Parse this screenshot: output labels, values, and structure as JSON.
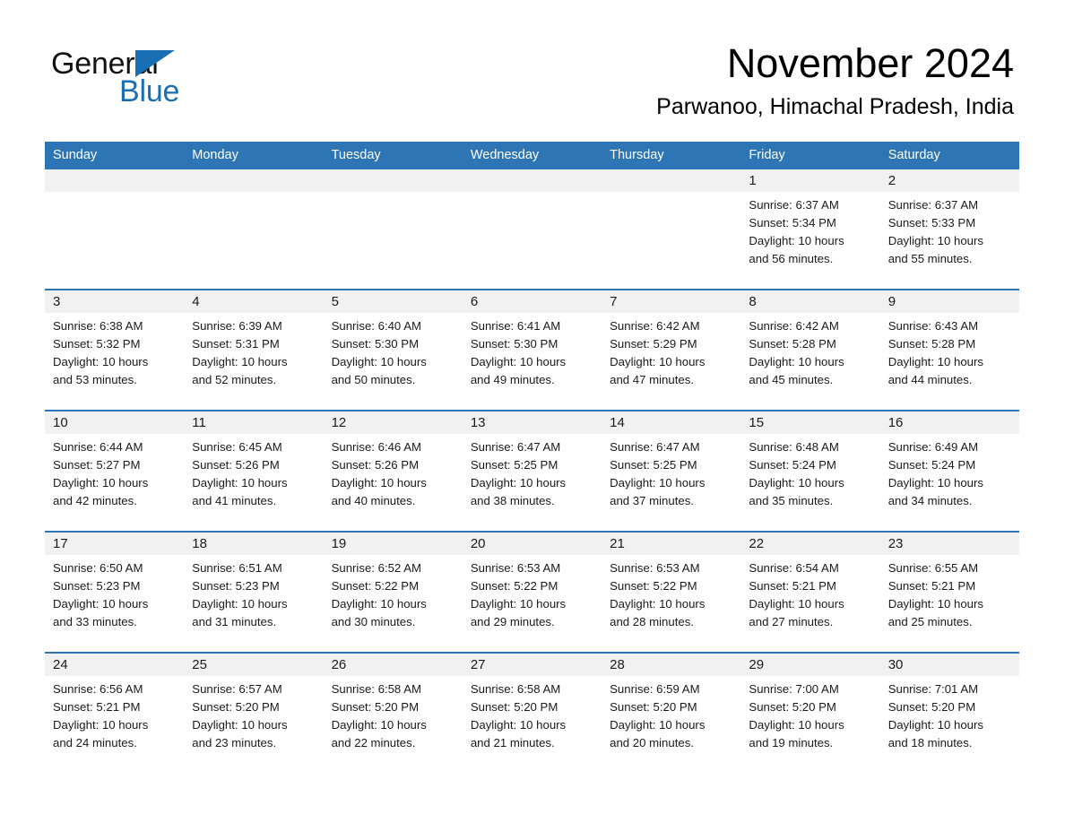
{
  "brand": {
    "name_part1": "General",
    "name_part2": "Blue",
    "accent_color": "#1a6fb4"
  },
  "header": {
    "month_title": "November 2024",
    "location": "Parwanoo, Himachal Pradesh, India"
  },
  "theme": {
    "header_blue": "#2e75b6",
    "day_band_gray": "#f1f1f1",
    "cell_white": "#ffffff"
  },
  "calendar": {
    "weekdays": [
      "Sunday",
      "Monday",
      "Tuesday",
      "Wednesday",
      "Thursday",
      "Friday",
      "Saturday"
    ],
    "weeks": [
      [
        {
          "day": "",
          "sunrise": "",
          "sunset": "",
          "daylight_line1": "",
          "daylight_line2": "",
          "empty": true
        },
        {
          "day": "",
          "sunrise": "",
          "sunset": "",
          "daylight_line1": "",
          "daylight_line2": "",
          "empty": true
        },
        {
          "day": "",
          "sunrise": "",
          "sunset": "",
          "daylight_line1": "",
          "daylight_line2": "",
          "empty": true
        },
        {
          "day": "",
          "sunrise": "",
          "sunset": "",
          "daylight_line1": "",
          "daylight_line2": "",
          "empty": true
        },
        {
          "day": "",
          "sunrise": "",
          "sunset": "",
          "daylight_line1": "",
          "daylight_line2": "",
          "empty": true
        },
        {
          "day": "1",
          "sunrise": "Sunrise: 6:37 AM",
          "sunset": "Sunset: 5:34 PM",
          "daylight_line1": "Daylight: 10 hours",
          "daylight_line2": "and 56 minutes."
        },
        {
          "day": "2",
          "sunrise": "Sunrise: 6:37 AM",
          "sunset": "Sunset: 5:33 PM",
          "daylight_line1": "Daylight: 10 hours",
          "daylight_line2": "and 55 minutes."
        }
      ],
      [
        {
          "day": "3",
          "sunrise": "Sunrise: 6:38 AM",
          "sunset": "Sunset: 5:32 PM",
          "daylight_line1": "Daylight: 10 hours",
          "daylight_line2": "and 53 minutes."
        },
        {
          "day": "4",
          "sunrise": "Sunrise: 6:39 AM",
          "sunset": "Sunset: 5:31 PM",
          "daylight_line1": "Daylight: 10 hours",
          "daylight_line2": "and 52 minutes."
        },
        {
          "day": "5",
          "sunrise": "Sunrise: 6:40 AM",
          "sunset": "Sunset: 5:30 PM",
          "daylight_line1": "Daylight: 10 hours",
          "daylight_line2": "and 50 minutes."
        },
        {
          "day": "6",
          "sunrise": "Sunrise: 6:41 AM",
          "sunset": "Sunset: 5:30 PM",
          "daylight_line1": "Daylight: 10 hours",
          "daylight_line2": "and 49 minutes."
        },
        {
          "day": "7",
          "sunrise": "Sunrise: 6:42 AM",
          "sunset": "Sunset: 5:29 PM",
          "daylight_line1": "Daylight: 10 hours",
          "daylight_line2": "and 47 minutes."
        },
        {
          "day": "8",
          "sunrise": "Sunrise: 6:42 AM",
          "sunset": "Sunset: 5:28 PM",
          "daylight_line1": "Daylight: 10 hours",
          "daylight_line2": "and 45 minutes."
        },
        {
          "day": "9",
          "sunrise": "Sunrise: 6:43 AM",
          "sunset": "Sunset: 5:28 PM",
          "daylight_line1": "Daylight: 10 hours",
          "daylight_line2": "and 44 minutes."
        }
      ],
      [
        {
          "day": "10",
          "sunrise": "Sunrise: 6:44 AM",
          "sunset": "Sunset: 5:27 PM",
          "daylight_line1": "Daylight: 10 hours",
          "daylight_line2": "and 42 minutes."
        },
        {
          "day": "11",
          "sunrise": "Sunrise: 6:45 AM",
          "sunset": "Sunset: 5:26 PM",
          "daylight_line1": "Daylight: 10 hours",
          "daylight_line2": "and 41 minutes."
        },
        {
          "day": "12",
          "sunrise": "Sunrise: 6:46 AM",
          "sunset": "Sunset: 5:26 PM",
          "daylight_line1": "Daylight: 10 hours",
          "daylight_line2": "and 40 minutes."
        },
        {
          "day": "13",
          "sunrise": "Sunrise: 6:47 AM",
          "sunset": "Sunset: 5:25 PM",
          "daylight_line1": "Daylight: 10 hours",
          "daylight_line2": "and 38 minutes."
        },
        {
          "day": "14",
          "sunrise": "Sunrise: 6:47 AM",
          "sunset": "Sunset: 5:25 PM",
          "daylight_line1": "Daylight: 10 hours",
          "daylight_line2": "and 37 minutes."
        },
        {
          "day": "15",
          "sunrise": "Sunrise: 6:48 AM",
          "sunset": "Sunset: 5:24 PM",
          "daylight_line1": "Daylight: 10 hours",
          "daylight_line2": "and 35 minutes."
        },
        {
          "day": "16",
          "sunrise": "Sunrise: 6:49 AM",
          "sunset": "Sunset: 5:24 PM",
          "daylight_line1": "Daylight: 10 hours",
          "daylight_line2": "and 34 minutes."
        }
      ],
      [
        {
          "day": "17",
          "sunrise": "Sunrise: 6:50 AM",
          "sunset": "Sunset: 5:23 PM",
          "daylight_line1": "Daylight: 10 hours",
          "daylight_line2": "and 33 minutes."
        },
        {
          "day": "18",
          "sunrise": "Sunrise: 6:51 AM",
          "sunset": "Sunset: 5:23 PM",
          "daylight_line1": "Daylight: 10 hours",
          "daylight_line2": "and 31 minutes."
        },
        {
          "day": "19",
          "sunrise": "Sunrise: 6:52 AM",
          "sunset": "Sunset: 5:22 PM",
          "daylight_line1": "Daylight: 10 hours",
          "daylight_line2": "and 30 minutes."
        },
        {
          "day": "20",
          "sunrise": "Sunrise: 6:53 AM",
          "sunset": "Sunset: 5:22 PM",
          "daylight_line1": "Daylight: 10 hours",
          "daylight_line2": "and 29 minutes."
        },
        {
          "day": "21",
          "sunrise": "Sunrise: 6:53 AM",
          "sunset": "Sunset: 5:22 PM",
          "daylight_line1": "Daylight: 10 hours",
          "daylight_line2": "and 28 minutes."
        },
        {
          "day": "22",
          "sunrise": "Sunrise: 6:54 AM",
          "sunset": "Sunset: 5:21 PM",
          "daylight_line1": "Daylight: 10 hours",
          "daylight_line2": "and 27 minutes."
        },
        {
          "day": "23",
          "sunrise": "Sunrise: 6:55 AM",
          "sunset": "Sunset: 5:21 PM",
          "daylight_line1": "Daylight: 10 hours",
          "daylight_line2": "and 25 minutes."
        }
      ],
      [
        {
          "day": "24",
          "sunrise": "Sunrise: 6:56 AM",
          "sunset": "Sunset: 5:21 PM",
          "daylight_line1": "Daylight: 10 hours",
          "daylight_line2": "and 24 minutes."
        },
        {
          "day": "25",
          "sunrise": "Sunrise: 6:57 AM",
          "sunset": "Sunset: 5:20 PM",
          "daylight_line1": "Daylight: 10 hours",
          "daylight_line2": "and 23 minutes."
        },
        {
          "day": "26",
          "sunrise": "Sunrise: 6:58 AM",
          "sunset": "Sunset: 5:20 PM",
          "daylight_line1": "Daylight: 10 hours",
          "daylight_line2": "and 22 minutes."
        },
        {
          "day": "27",
          "sunrise": "Sunrise: 6:58 AM",
          "sunset": "Sunset: 5:20 PM",
          "daylight_line1": "Daylight: 10 hours",
          "daylight_line2": "and 21 minutes."
        },
        {
          "day": "28",
          "sunrise": "Sunrise: 6:59 AM",
          "sunset": "Sunset: 5:20 PM",
          "daylight_line1": "Daylight: 10 hours",
          "daylight_line2": "and 20 minutes."
        },
        {
          "day": "29",
          "sunrise": "Sunrise: 7:00 AM",
          "sunset": "Sunset: 5:20 PM",
          "daylight_line1": "Daylight: 10 hours",
          "daylight_line2": "and 19 minutes."
        },
        {
          "day": "30",
          "sunrise": "Sunrise: 7:01 AM",
          "sunset": "Sunset: 5:20 PM",
          "daylight_line1": "Daylight: 10 hours",
          "daylight_line2": "and 18 minutes."
        }
      ]
    ]
  }
}
